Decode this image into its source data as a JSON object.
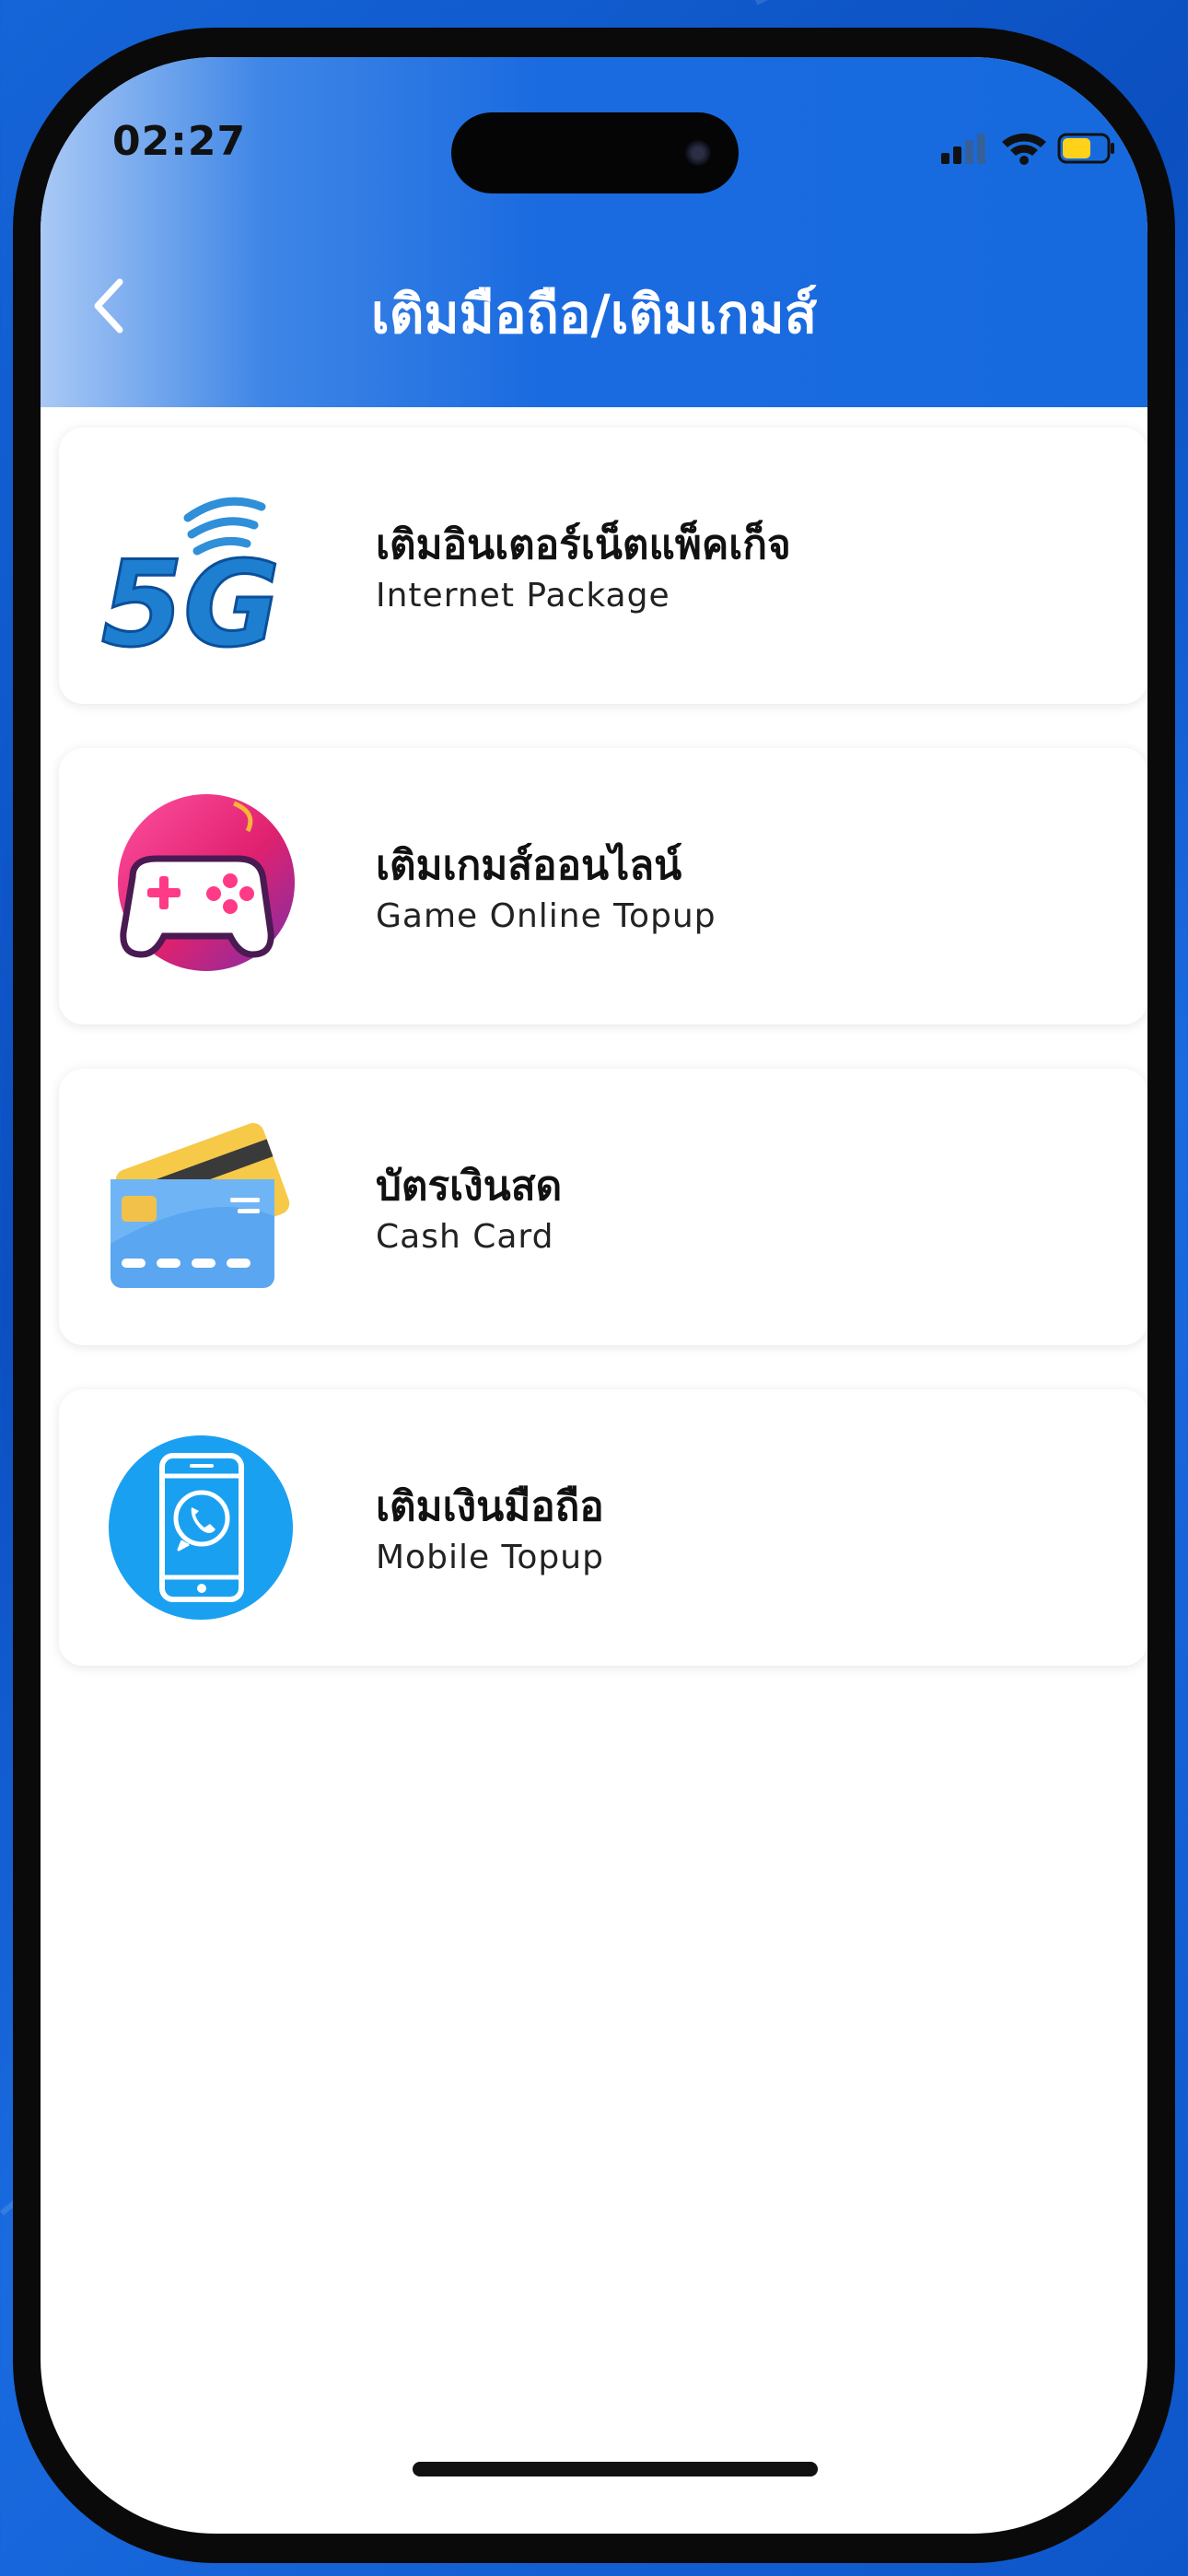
{
  "status_bar": {
    "time": "02:27"
  },
  "header": {
    "title": "เติมมือถือ/เติมเกมส์",
    "back_icon": "chevron-left-icon"
  },
  "menu": [
    {
      "title_th": "เติมอินเตอร์เน็ตแพ็คเก็จ",
      "title_en": "Internet Package",
      "icon": "5g-icon"
    },
    {
      "title_th": "เติมเกมส์ออนไลน์",
      "title_en": "Game Online Topup",
      "icon": "gamepad-icon"
    },
    {
      "title_th": "บัตรเงินสด",
      "title_en": "Cash Card",
      "icon": "cash-card-icon"
    },
    {
      "title_th": "เติมเงินมือถือ",
      "title_en": "Mobile Topup",
      "icon": "mobile-phone-icon"
    }
  ],
  "colors": {
    "header_blue": "#166ade",
    "accent_blue": "#1aa0f0",
    "background_blue": "#0b4fc0"
  }
}
